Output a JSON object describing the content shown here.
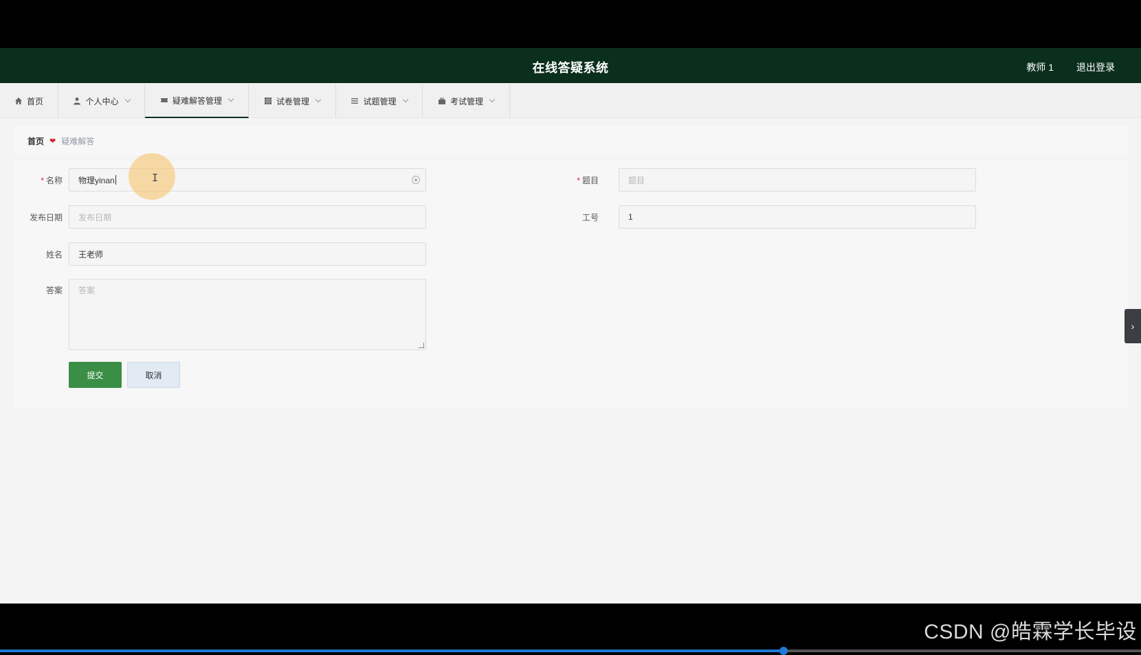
{
  "app": {
    "title": "在线答疑系统",
    "user": "教师 1",
    "logout": "退出登录"
  },
  "nav": {
    "items": [
      {
        "label": "首页",
        "icon": "home-icon"
      },
      {
        "label": "个人中心",
        "icon": "user-icon"
      },
      {
        "label": "疑难解答管理",
        "icon": "ticket-icon"
      },
      {
        "label": "试卷管理",
        "icon": "grid-icon"
      },
      {
        "label": "试题管理",
        "icon": "list-icon"
      },
      {
        "label": "考试管理",
        "icon": "briefcase-icon"
      }
    ],
    "active_index": 2
  },
  "breadcrumb": {
    "home": "首页",
    "separator_icon": "heart-icon",
    "current": "疑难解答"
  },
  "form": {
    "name_label": "名称",
    "name_value": "物理yinan",
    "title_label": "题目",
    "title_placeholder": "题目",
    "date_label": "发布日期",
    "date_placeholder": "发布日期",
    "jobno_label": "工号",
    "jobno_value": "1",
    "teacher_label": "姓名",
    "teacher_value": "王老师",
    "answer_label": "答案",
    "answer_placeholder": "答案",
    "submit": "提交",
    "cancel": "取消"
  },
  "watermark": "CSDN @皓霖学长毕设",
  "video_progress": 0.687,
  "colors": {
    "header_bg": "#0b2f1d",
    "primary_button": "#3a8e45",
    "required_mark": "#d6202e",
    "progress": "#1e7bd6"
  }
}
